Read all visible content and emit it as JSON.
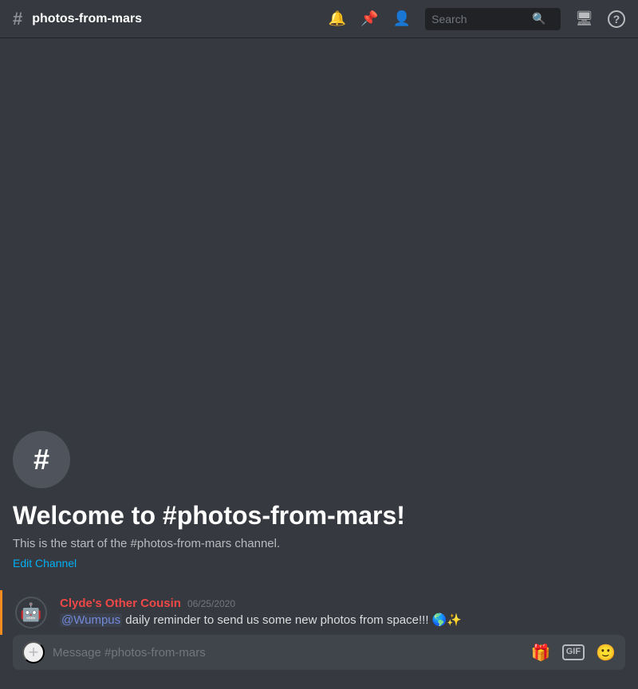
{
  "header": {
    "channel_name": "photos-from-mars",
    "hash_symbol": "#",
    "search_placeholder": "Search",
    "icons": {
      "bell": "🔔",
      "pin": "📌",
      "members": "👤",
      "inbox": "🖥",
      "help": "?"
    }
  },
  "welcome": {
    "icon_hash": "#",
    "title": "Welcome to #photos-from-mars!",
    "description": "This is the start of the #photos-from-mars channel.",
    "edit_label": "Edit Channel"
  },
  "messages": [
    {
      "author": "Clyde's Other Cousin",
      "timestamp": "06/25/2020",
      "mention": "@Wumpus",
      "content": " daily reminder to send us some new photos from space!!! 🌎✨",
      "avatar_emoji": "🤖",
      "accent_color": "#f48c21"
    }
  ],
  "input": {
    "placeholder": "Message #photos-from-mars",
    "add_label": "+",
    "gift_label": "🎁",
    "gif_label": "GIF",
    "emoji_label": "🙂"
  }
}
